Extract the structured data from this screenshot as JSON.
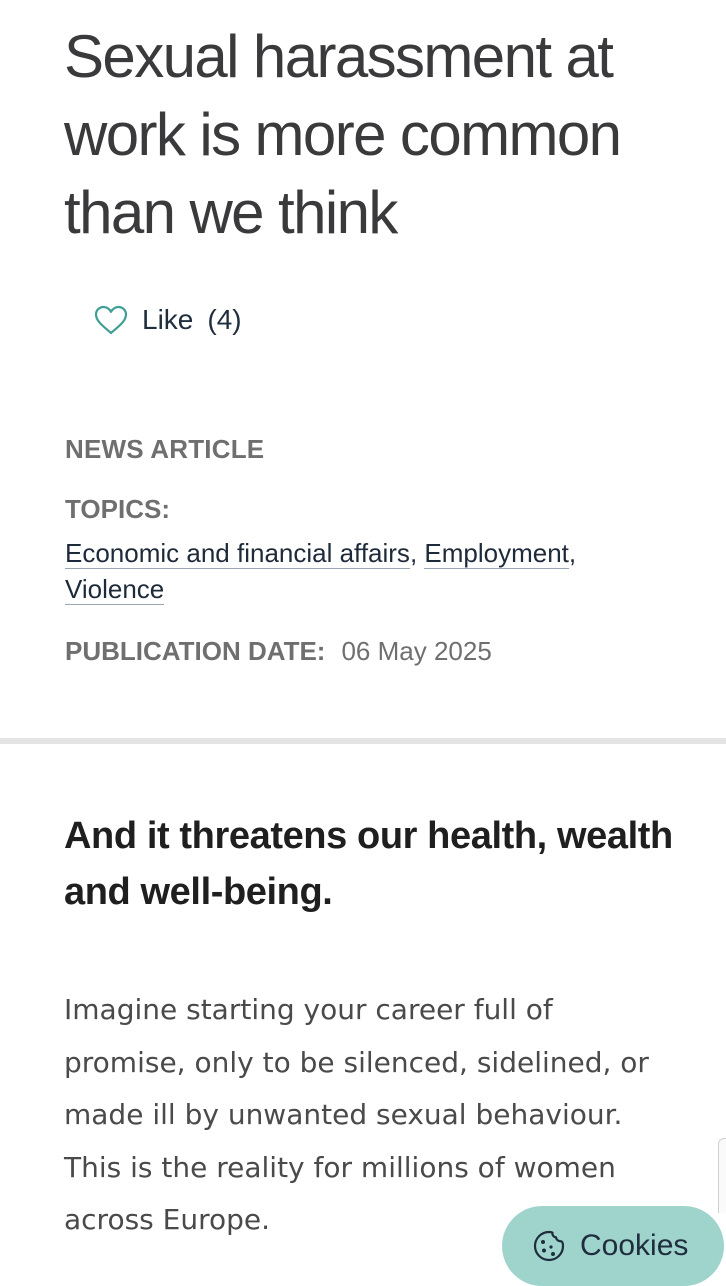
{
  "article": {
    "title": "Sexual harassment at work is more common than we think",
    "like_label": "Like",
    "like_count": "(4)",
    "type": "NEWS ARTICLE",
    "topics_label": "TOPICS:",
    "topics": [
      "Economic and financial affairs",
      "Employment",
      "Violence"
    ],
    "topic_separator": ",",
    "publication_label": "PUBLICATION DATE:",
    "publication_date": "06 May 2025",
    "subheading": "And it threatens our health, wealth and well-being.",
    "body": "Imagine starting your career full of promise, only to be silenced, sidelined, or made ill by unwanted sexual behaviour. This is the reality for millions of women across Europe."
  },
  "cookies": {
    "label": "Cookies"
  },
  "icons": {
    "like": "heart-outline-icon",
    "cookies": "cookie-icon"
  },
  "colors": {
    "accent_teal": "#3f9f95",
    "cookies_button_bg": "#9fd4cd",
    "meta_grey": "#6f6f6f",
    "link_navy": "#1e2a3a"
  }
}
